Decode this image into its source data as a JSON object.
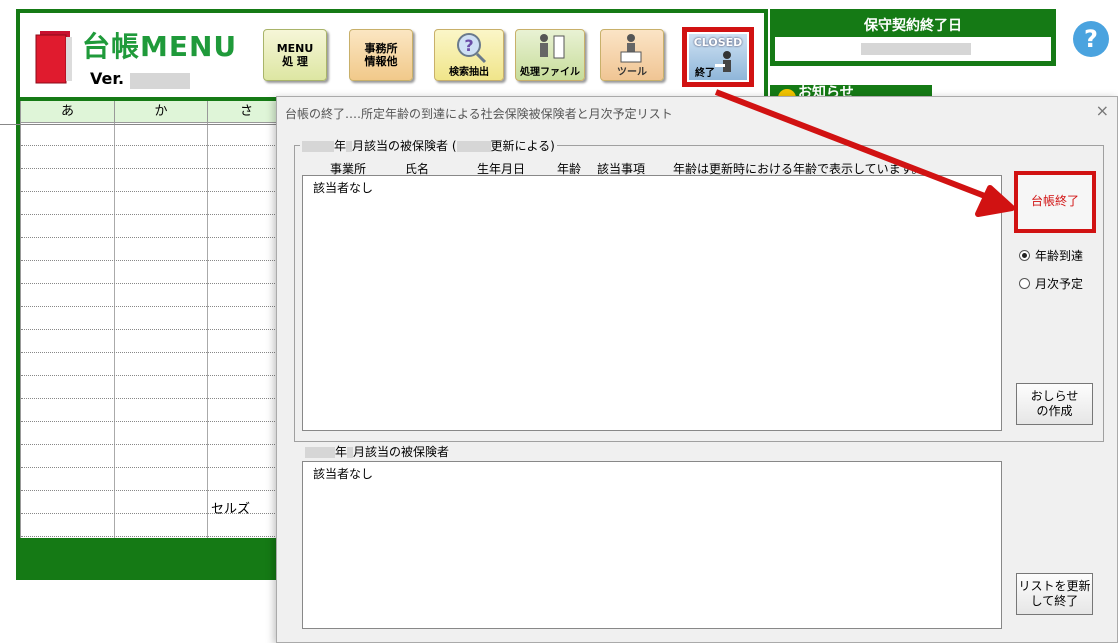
{
  "app": {
    "title": "台帳MENU",
    "version_label": "Ver.",
    "buttons": {
      "menu_line1": "MENU",
      "menu_line2": "処 理",
      "office_line1": "事務所",
      "office_line2": "情報他",
      "search": "検索抽出",
      "file": "処理ファイル",
      "tool": "ツール",
      "closed_top": "CLOSED",
      "closed_bottom": "終了"
    },
    "grid": {
      "headers": [
        "あ",
        "か",
        "さ"
      ],
      "cell_text": "セルズ"
    }
  },
  "contract": {
    "title": "保守契約終了日"
  },
  "news": {
    "title": "お知らせ"
  },
  "help": {
    "label": "?"
  },
  "dialog": {
    "title": "台帳の終了‥‥所定年齢の到達による社会保険被保険者と月次予定リスト",
    "close": "×",
    "group1_label_a": "年",
    "group1_label_b": "月該当の被保険者 (",
    "group1_label_c": "更新による)",
    "columns": [
      "事業所",
      "氏名",
      "生年月日",
      "年齢",
      "該当事項"
    ],
    "age_note": "年齢は更新時における年齢で表示しています。",
    "list1_text": "該当者なし",
    "group2_label_a": "年",
    "group2_label_b": "月該当の被保険者",
    "list2_text": "該当者なし",
    "end_button": "台帳終了",
    "radio_age": "年齢到達",
    "radio_monthly": "月次予定",
    "notice_line1": "おしらせ",
    "notice_line2": "の作成",
    "refresh_line1": "リストを更新",
    "refresh_line2": "して終了"
  },
  "colors": {
    "accent_green": "#157a15",
    "highlight_red": "#d11212"
  }
}
